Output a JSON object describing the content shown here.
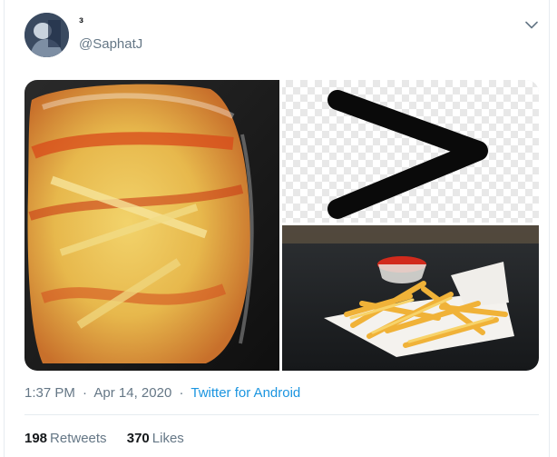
{
  "tweet": {
    "display_name": "з",
    "handle": "@SaphatJ",
    "timestamp": {
      "time": "1:37 PM",
      "date": "Apr 14, 2020",
      "separator": "·",
      "source": "Twitter for Android"
    },
    "stats": {
      "retweets_count": "198",
      "retweets_label": "Retweets",
      "likes_count": "370",
      "likes_label": "Likes"
    }
  },
  "media": [
    {
      "name": "fries-in-plastic-bag-with-ketchup"
    },
    {
      "name": "greater-than-sign"
    },
    {
      "name": "french-fries-with-ketchup-cup"
    }
  ],
  "icons": {
    "more": "chevron-down-icon"
  },
  "colors": {
    "link": "#1b95e0",
    "secondary_text": "#657786",
    "primary_text": "#14171a",
    "divider": "#e6ecf0"
  }
}
